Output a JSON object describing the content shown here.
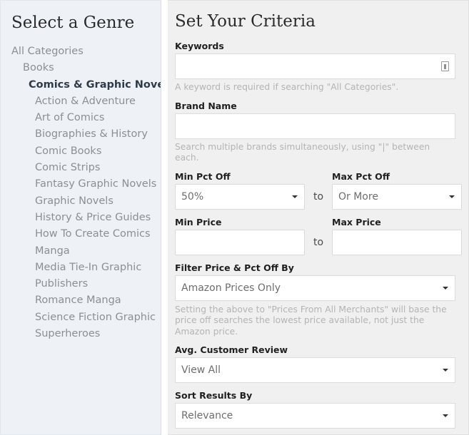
{
  "sidebar": {
    "title": "Select a Genre",
    "items": [
      {
        "label": "All Categories",
        "level": 0,
        "selected": false
      },
      {
        "label": "Books",
        "level": 1,
        "selected": false
      },
      {
        "label": "Comics & Graphic Novels",
        "level": 2,
        "selected": true
      },
      {
        "label": "Action & Adventure",
        "level": 3,
        "selected": false
      },
      {
        "label": "Art of Comics",
        "level": 3,
        "selected": false
      },
      {
        "label": "Biographies & History",
        "level": 3,
        "selected": false
      },
      {
        "label": "Comic Books",
        "level": 3,
        "selected": false
      },
      {
        "label": "Comic Strips",
        "level": 3,
        "selected": false
      },
      {
        "label": "Fantasy Graphic Novels",
        "level": 3,
        "selected": false
      },
      {
        "label": "Graphic Novels",
        "level": 3,
        "selected": false
      },
      {
        "label": "History & Price Guides",
        "level": 3,
        "selected": false
      },
      {
        "label": "How To Create Comics",
        "level": 3,
        "selected": false
      },
      {
        "label": "Manga",
        "level": 3,
        "selected": false
      },
      {
        "label": "Media Tie-In Graphic",
        "level": 3,
        "selected": false
      },
      {
        "label": "Publishers",
        "level": 3,
        "selected": false
      },
      {
        "label": "Romance Manga",
        "level": 3,
        "selected": false
      },
      {
        "label": "Science Fiction Graphic",
        "level": 3,
        "selected": false
      },
      {
        "label": "Superheroes",
        "level": 3,
        "selected": false
      }
    ]
  },
  "panel": {
    "title": "Set Your Criteria",
    "keywords": {
      "label": "Keywords",
      "value": "",
      "placeholder": "",
      "hint": "A keyword is required if searching \"All Categories\".",
      "icon": "clipboard-icon"
    },
    "brand_name": {
      "label": "Brand Name",
      "value": "",
      "placeholder": "",
      "hint": "Search multiple brands simultaneously, using \"|\" between each."
    },
    "min_pct_off": {
      "label": "Min Pct Off",
      "value": "50%"
    },
    "max_pct_off": {
      "label": "Max Pct Off",
      "value": "Or More"
    },
    "pct_connector": "to",
    "min_price": {
      "label": "Min Price",
      "value": "",
      "placeholder": ""
    },
    "max_price": {
      "label": "Max Price",
      "value": "",
      "placeholder": ""
    },
    "price_connector": "to",
    "filter_by": {
      "label": "Filter Price & Pct Off By",
      "value": "Amazon Prices Only",
      "hint": "Setting the above to \"Prices From All Merchants\" will base the price off searches the lowest price available, not just the Amazon price."
    },
    "avg_review": {
      "label": "Avg. Customer Review",
      "value": "View All"
    },
    "sort_by": {
      "label": "Sort Results By",
      "value": "Relevance"
    }
  },
  "colors": {
    "sidebar_bg": "#eef2f7",
    "panel_bg": "#f0f0f0",
    "selected_text": "#2f3b48",
    "muted_text": "#8a8f96",
    "hint_text": "#b4b4b4"
  }
}
